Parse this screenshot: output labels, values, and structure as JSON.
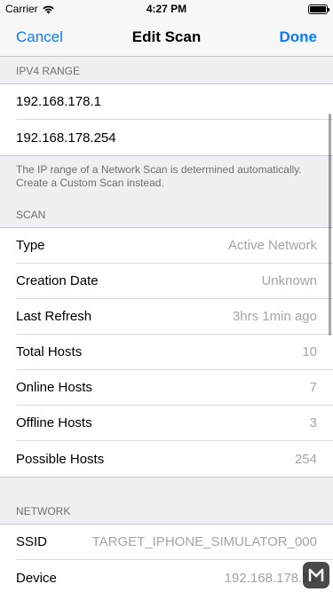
{
  "status_bar": {
    "carrier": "Carrier",
    "time": "4:27 PM"
  },
  "nav": {
    "cancel_label": "Cancel",
    "title": "Edit Scan",
    "done_label": "Done"
  },
  "ipv4_section": {
    "header": "IPv4 Range",
    "start_ip": "192.168.178.1",
    "end_ip": "192.168.178.254",
    "footer": "The IP range of a Network Scan is determined automatically. Create a Custom Scan instead."
  },
  "scan_section": {
    "header": "Scan",
    "rows": [
      {
        "label": "Type",
        "value": "Active Network"
      },
      {
        "label": "Creation Date",
        "value": "Unknown"
      },
      {
        "label": "Last Refresh",
        "value": "3hrs 1min ago"
      },
      {
        "label": "Total Hosts",
        "value": "10"
      },
      {
        "label": "Online Hosts",
        "value": "7"
      },
      {
        "label": "Offline Hosts",
        "value": "3"
      },
      {
        "label": "Possible Hosts",
        "value": "254"
      }
    ]
  },
  "network_section": {
    "header": "Network",
    "rows": [
      {
        "label": "SSID",
        "value": "TARGET_IPHONE_SIMULATOR_000"
      },
      {
        "label": "Device",
        "value": "192.168.178.21"
      }
    ]
  },
  "colors": {
    "accent": "#0a7aff",
    "background": "#efeff4",
    "secondary_text": "#a4a4a8"
  }
}
